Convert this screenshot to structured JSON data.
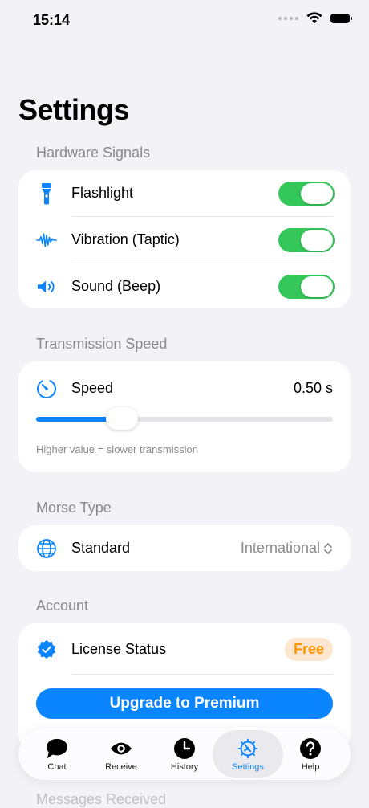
{
  "status_bar": {
    "time": "15:14"
  },
  "title": "Settings",
  "hardware": {
    "header": "Hardware Signals",
    "items": [
      {
        "label": "Flashlight",
        "icon": "flashlight-icon",
        "on": true
      },
      {
        "label": "Vibration (Taptic)",
        "icon": "waveform-icon",
        "on": true
      },
      {
        "label": "Sound (Beep)",
        "icon": "speaker-icon",
        "on": true
      }
    ]
  },
  "transmission": {
    "header": "Transmission Speed",
    "label": "Speed",
    "value": "0.50 s",
    "slider_fraction": 0.29,
    "hint": "Higher value = slower transmission"
  },
  "morse": {
    "header": "Morse Type",
    "label": "Standard",
    "selected": "International"
  },
  "account": {
    "header": "Account",
    "license_label": "License Status",
    "license_value": "Free",
    "upgrade_label": "Upgrade to Premium"
  },
  "faded_below": {
    "line2": "Messages Received"
  },
  "tabs": [
    {
      "label": "Chat",
      "icon": "chat-bubble-icon",
      "active": false
    },
    {
      "label": "Receive",
      "icon": "eye-icon",
      "active": false
    },
    {
      "label": "History",
      "icon": "clock-icon",
      "active": false
    },
    {
      "label": "Settings",
      "icon": "gear-icon",
      "active": true
    },
    {
      "label": "Help",
      "icon": "question-icon",
      "active": false
    }
  ],
  "colors": {
    "accent": "#0a84ff",
    "toggle_on": "#34c759",
    "badge": "#ff9500",
    "background": "#f2f2f7"
  }
}
